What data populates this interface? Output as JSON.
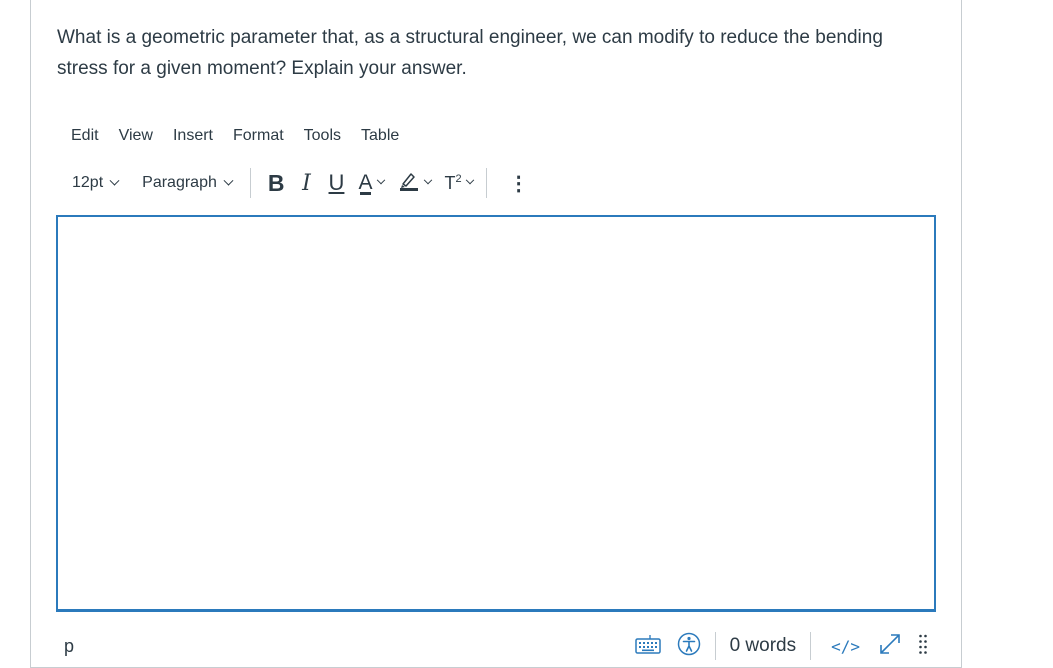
{
  "question": {
    "text": "What is a geometric parameter that, as a structural engineer, we can modify to reduce the bending stress for a given moment? Explain your answer."
  },
  "menubar": {
    "items": [
      "Edit",
      "View",
      "Insert",
      "Format",
      "Tools",
      "Table"
    ]
  },
  "toolbar": {
    "font_size": "12pt",
    "block_format": "Paragraph",
    "bold_label": "B",
    "italic_label": "I",
    "underline_label": "U",
    "text_color_label": "A",
    "superscript_label": "T",
    "superscript_mark": "2",
    "more_label": "⋮"
  },
  "editor": {
    "content": ""
  },
  "statusbar": {
    "path": "p",
    "word_count": "0 words",
    "html_toggle_label": "</>",
    "accent_color": "#2b7abc"
  },
  "icons": [
    "chevron-down-icon",
    "highlighter-icon",
    "keyboard-icon",
    "accessibility-icon",
    "fullscreen-icon",
    "resize-grip-icon"
  ]
}
